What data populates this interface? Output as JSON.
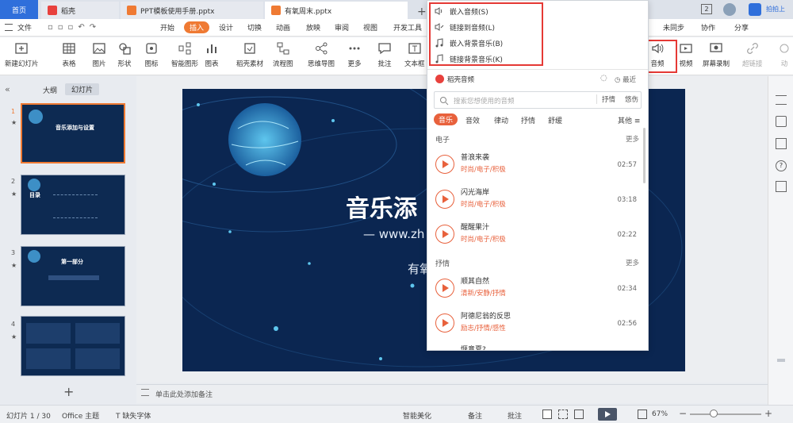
{
  "tabs": {
    "home": "首页",
    "docer": "稻壳",
    "file1": "PPT模板使用手册.pptx",
    "file2": "有氧周末.pptx",
    "add": "+"
  },
  "titlebar_right": {
    "badge": "2",
    "promo": "分享",
    "login": "拍拍上"
  },
  "menu": {
    "file": "文件",
    "start": "开始",
    "insert": "插入",
    "design": "设计",
    "transition": "切换",
    "animation": "动画",
    "slideshow": "放映",
    "review": "审阅",
    "view": "视图",
    "devtools": "开发工具",
    "unsync": "未同步",
    "collab": "协作",
    "share": "分享"
  },
  "ribbon": {
    "new_slide": "新建幻灯片",
    "table": "表格",
    "picture": "图片",
    "shape": "形状",
    "icon": "图标",
    "smartart": "智能图形",
    "chart": "图表",
    "docer_material": "稻壳素材",
    "flowchart": "流程图",
    "mindmap": "思维导图",
    "more": "更多",
    "comment": "批注",
    "textbox": "文本框",
    "audio": "音频",
    "video": "视频",
    "screen_record": "屏幕录制",
    "hyperlink": "超链接",
    "action": "动"
  },
  "leftpane": {
    "tab_outline": "大纲",
    "tab_slides": "幻灯片",
    "slides": [
      {
        "num": "1",
        "title": "音乐添加与设置"
      },
      {
        "num": "2",
        "title": "目录"
      },
      {
        "num": "3",
        "title": "第一部分"
      },
      {
        "num": "4",
        "title": ""
      }
    ],
    "add": "+"
  },
  "slide": {
    "title": "音乐添",
    "subtitle": "— www.zh",
    "text3": "有氧"
  },
  "notes": {
    "placeholder": "单击此处添加备注"
  },
  "status": {
    "slide_count": "幻灯片 1 / 30",
    "theme": "Office 主题",
    "missing_font": "缺失字体",
    "smart_beautify": "智能美化",
    "notes": "备注",
    "comment": "批注",
    "zoom": "67%",
    "zoom_level": 0.67
  },
  "audio_menu": {
    "embed_audio": "嵌入音频(S)",
    "link_audio": "链接到音频(L)",
    "embed_bgm": "嵌入背景音乐(B)",
    "link_bgm": "链接背景音乐(K)",
    "source": "稻壳音频",
    "recent": "最近",
    "search_placeholder": "搜索您想使用的音频",
    "tag1": "抒情",
    "tag2": "悠伤",
    "categories": [
      "音乐",
      "音效",
      "律动",
      "抒情",
      "舒缓"
    ],
    "other": "其他",
    "section1": "电子",
    "section2": "抒情",
    "more": "更多",
    "tracks": [
      {
        "name": "普浪来袭",
        "tags": "时尚/电子/积极",
        "dur": "02:57"
      },
      {
        "name": "闪光海岸",
        "tags": "时尚/电子/积极",
        "dur": "03:18"
      },
      {
        "name": "醒醒果汁",
        "tags": "时尚/电子/积极",
        "dur": "02:22"
      },
      {
        "name": "顺其自然",
        "tags": "清新/安静/抒情",
        "dur": "02:34"
      },
      {
        "name": "阿德尼翁的反思",
        "tags": "励志/抒情/感性",
        "dur": "02:56"
      },
      {
        "name": "惬意夏? ",
        "tags": "",
        "dur": ""
      }
    ]
  },
  "colors": {
    "accent": "#ef7a33",
    "blue": "#2f6fdb",
    "highlight_red": "#e53935",
    "slide_bg": "#0b2651"
  }
}
